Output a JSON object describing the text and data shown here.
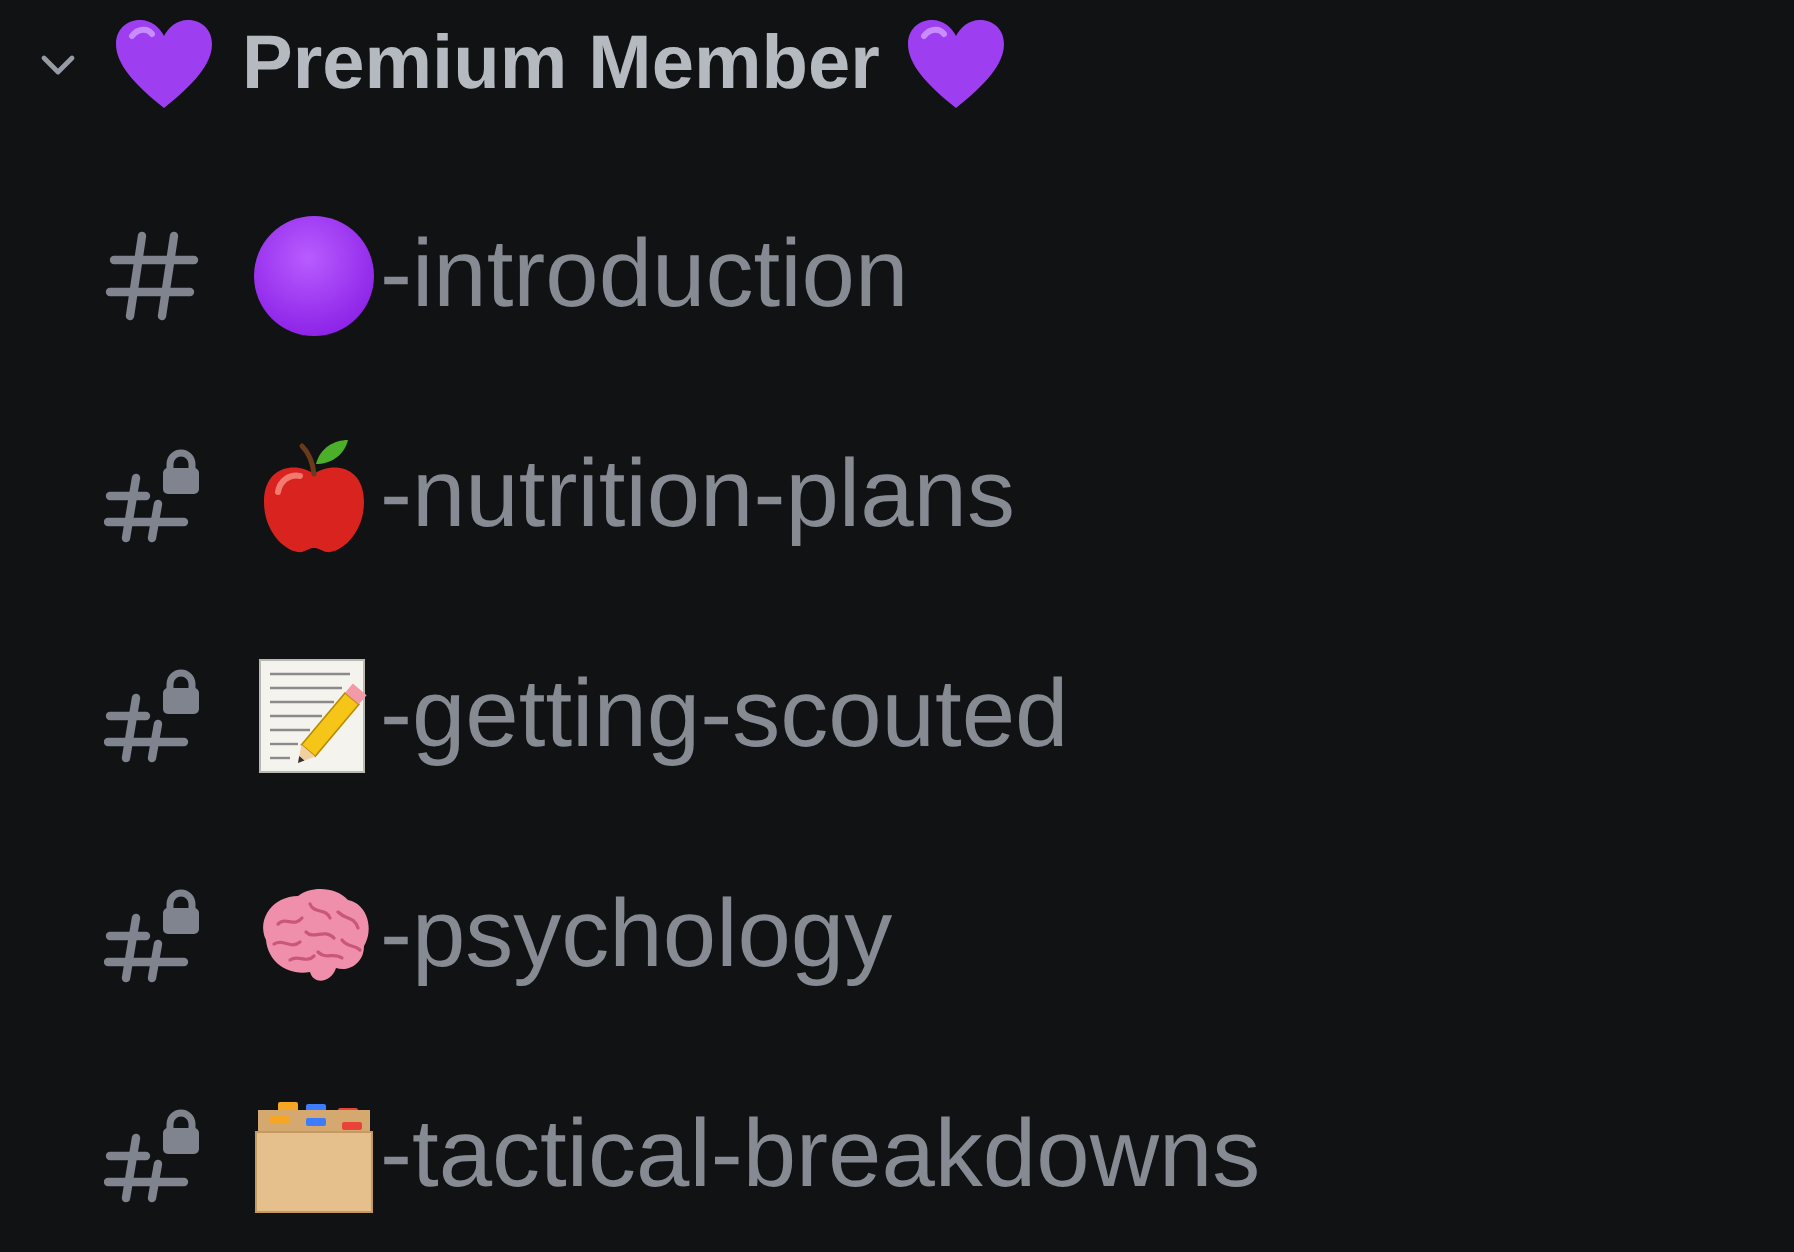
{
  "category": {
    "name": "Premium Member",
    "expanded": true
  },
  "channels": [
    {
      "name": "-introduction",
      "kind": "circle",
      "locked": false
    },
    {
      "name": "-nutrition-plans",
      "kind": "apple",
      "locked": true
    },
    {
      "name": "-getting-scouted",
      "kind": "memo",
      "locked": true
    },
    {
      "name": "-psychology",
      "kind": "brain",
      "locked": true
    },
    {
      "name": "-tactical-breakdowns",
      "kind": "file-box",
      "locked": true
    }
  ]
}
